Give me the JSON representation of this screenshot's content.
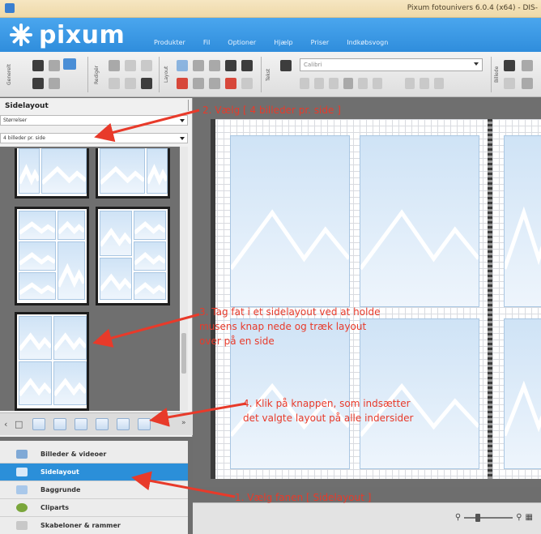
{
  "window": {
    "title": "Pixum fotounivers 6.0.4 (x64) - DIS-"
  },
  "brand": {
    "name": "pixum"
  },
  "menu": [
    "Produkter",
    "Fil",
    "Optioner",
    "Hjælp",
    "Priser",
    "Indkøbsvogn"
  ],
  "toolbar": {
    "font_placeholder": "Calibri",
    "group_labels": [
      "Generelt",
      "Redigér",
      "Layout",
      "Tekst",
      "Billede"
    ]
  },
  "sidebar": {
    "title": "Sidelayout",
    "filter_select": "Størrelser",
    "layout_select": "4 billeder pr. side"
  },
  "tabs": [
    {
      "label": "Billeder & videoer",
      "icon": "photo-icon"
    },
    {
      "label": "Sidelayout",
      "icon": "layout-icon",
      "active": true
    },
    {
      "label": "Baggrunde",
      "icon": "background-icon"
    },
    {
      "label": "Cliparts",
      "icon": "clipart-icon"
    },
    {
      "label": "Skabeloner & rammer",
      "icon": "template-icon"
    }
  ],
  "annotations": {
    "step1": "1. Vælg fanen [ Sidelayout ]",
    "step2": "2. Vælg [ 4 billeder pr. side ]",
    "step3_l1": "3. Tag fat i et sidelayout ved at holde",
    "step3_l2": "musens knap nede og træk layout",
    "step3_l3": "over på en side",
    "step4_l1": "4. Klik på knappen, som indsætter",
    "step4_l2": "det valgte layout på alle indersider"
  },
  "colors": {
    "accent": "#2b8fd9",
    "annotation": "#e83a2a",
    "menubar": "#3b98e5"
  }
}
